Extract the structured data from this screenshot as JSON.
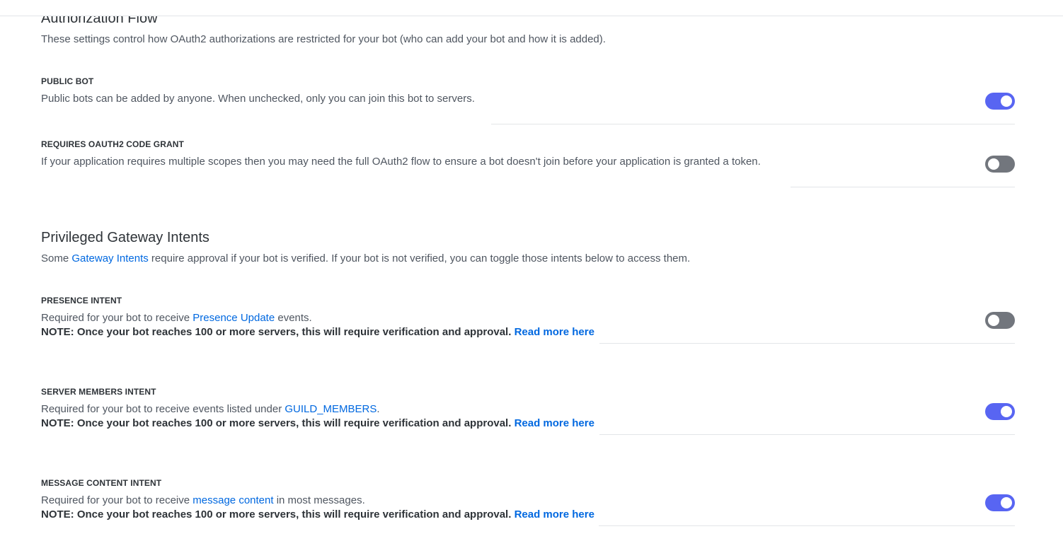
{
  "authorization_flow": {
    "title": "Authorization Flow",
    "description": "These settings control how OAuth2 authorizations are restricted for your bot (who can add your bot and how it is added).",
    "settings": [
      {
        "label": "PUBLIC BOT",
        "description": "Public bots can be added by anyone. When unchecked, only you can join this bot to servers.",
        "enabled": true
      },
      {
        "label": "REQUIRES OAUTH2 CODE GRANT",
        "description": "If your application requires multiple scopes then you may need the full OAuth2 flow to ensure a bot doesn't join before your application is granted a token.",
        "enabled": false
      }
    ]
  },
  "gateway_intents": {
    "title": "Privileged Gateway Intents",
    "description_prefix": "Some ",
    "description_link": "Gateway Intents",
    "description_suffix": " require approval if your bot is verified. If your bot is not verified, you can toggle those intents below to access them.",
    "note_text": "NOTE: Once your bot reaches 100 or more servers, this will require verification and approval.",
    "read_more_label": "Read more here",
    "intents": [
      {
        "label": "PRESENCE INTENT",
        "desc_prefix": "Required for your bot to receive ",
        "desc_link": "Presence Update",
        "desc_suffix": " events.",
        "enabled": false
      },
      {
        "label": "SERVER MEMBERS INTENT",
        "desc_prefix": "Required for your bot to receive events listed under ",
        "desc_link": "GUILD_MEMBERS",
        "desc_suffix": ".",
        "enabled": true
      },
      {
        "label": "MESSAGE CONTENT INTENT",
        "desc_prefix": "Required for your bot to receive ",
        "desc_link": "message content",
        "desc_suffix": " in most messages.",
        "enabled": true
      }
    ]
  },
  "colors": {
    "toggle_on": "#5865f2",
    "toggle_off": "#72767d",
    "link": "#0068e0"
  }
}
